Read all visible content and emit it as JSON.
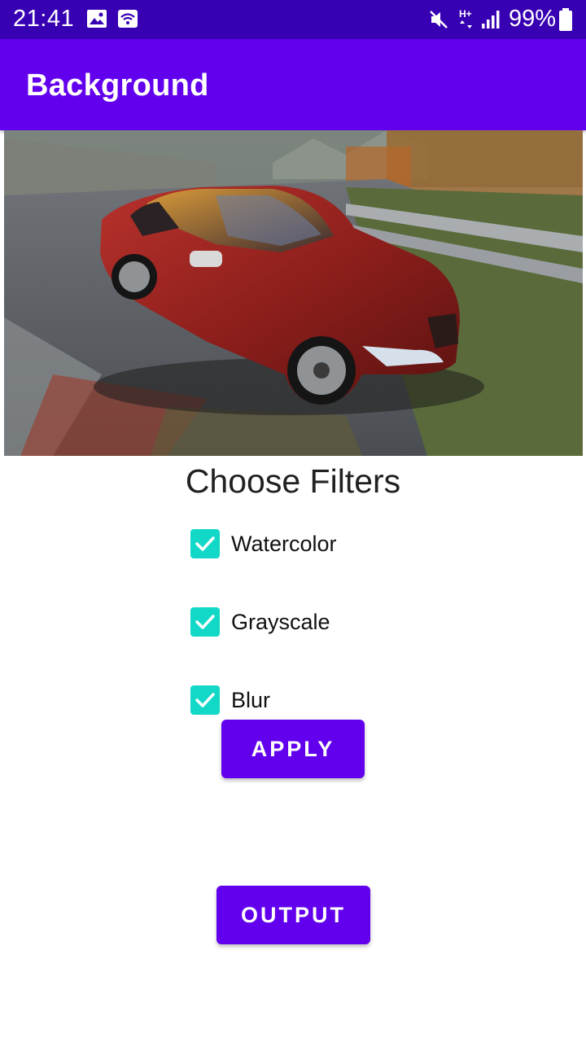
{
  "status_bar": {
    "time": "21:41",
    "battery_percent": "99%",
    "icons": [
      "image-icon",
      "wifi-hotspot-icon",
      "mute-icon",
      "h-plus-network-icon",
      "signal-icon",
      "battery-icon"
    ]
  },
  "app_bar": {
    "title": "Background"
  },
  "hero_image": {
    "subject": "red-coupe-motion-blur-photo"
  },
  "filters": {
    "title": "Choose Filters",
    "items": [
      {
        "label": "Watercolor",
        "checked": true
      },
      {
        "label": "Grayscale",
        "checked": true
      },
      {
        "label": "Blur",
        "checked": true
      }
    ],
    "accent_color": "#12d8c8"
  },
  "buttons": {
    "apply": "APPLY",
    "output": "OUTPUT"
  },
  "colors": {
    "status_bar": "#3700b3",
    "primary": "#6200ee"
  }
}
